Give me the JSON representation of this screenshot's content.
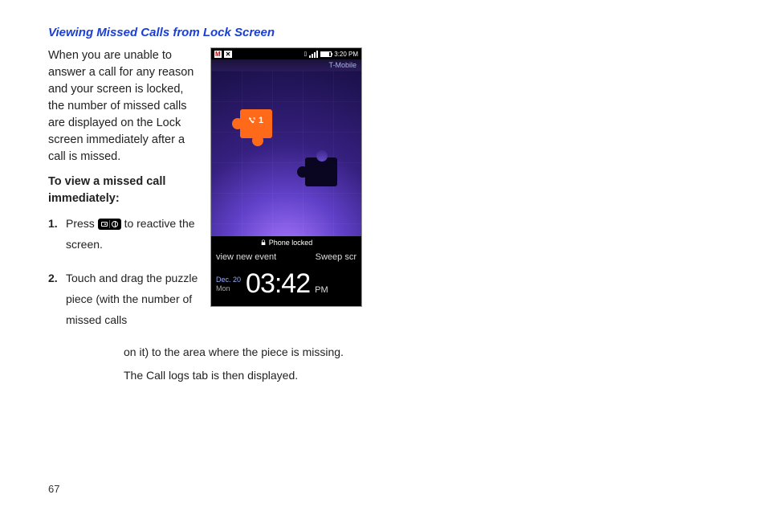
{
  "heading": "Viewing Missed Calls from Lock Screen",
  "intro": "When you are unable to answer a call for any reason and your screen is locked, the number of missed calls are displayed on the Lock screen immediately after a call is missed.",
  "subheading": "To view a missed call immediately:",
  "steps": {
    "s1_a": "Press ",
    "s1_b": " to reactive the screen.",
    "s2_a": "Touch and drag the puzzle piece (with the number of missed calls ",
    "s2_b": "on it) to the area where the piece is missing.",
    "s2_c": "The Call logs tab is then displayed."
  },
  "phone": {
    "status_time": "3:20 PM",
    "carrier": "T-Mobile",
    "missed_count": "1",
    "locked_text": "Phone locked",
    "hint_left": "view new event",
    "hint_right": "Sweep scr",
    "date_line1": "Dec. 20",
    "date_line2": "Mon",
    "time": "03:42",
    "ampm": "PM"
  },
  "page_number": "67"
}
